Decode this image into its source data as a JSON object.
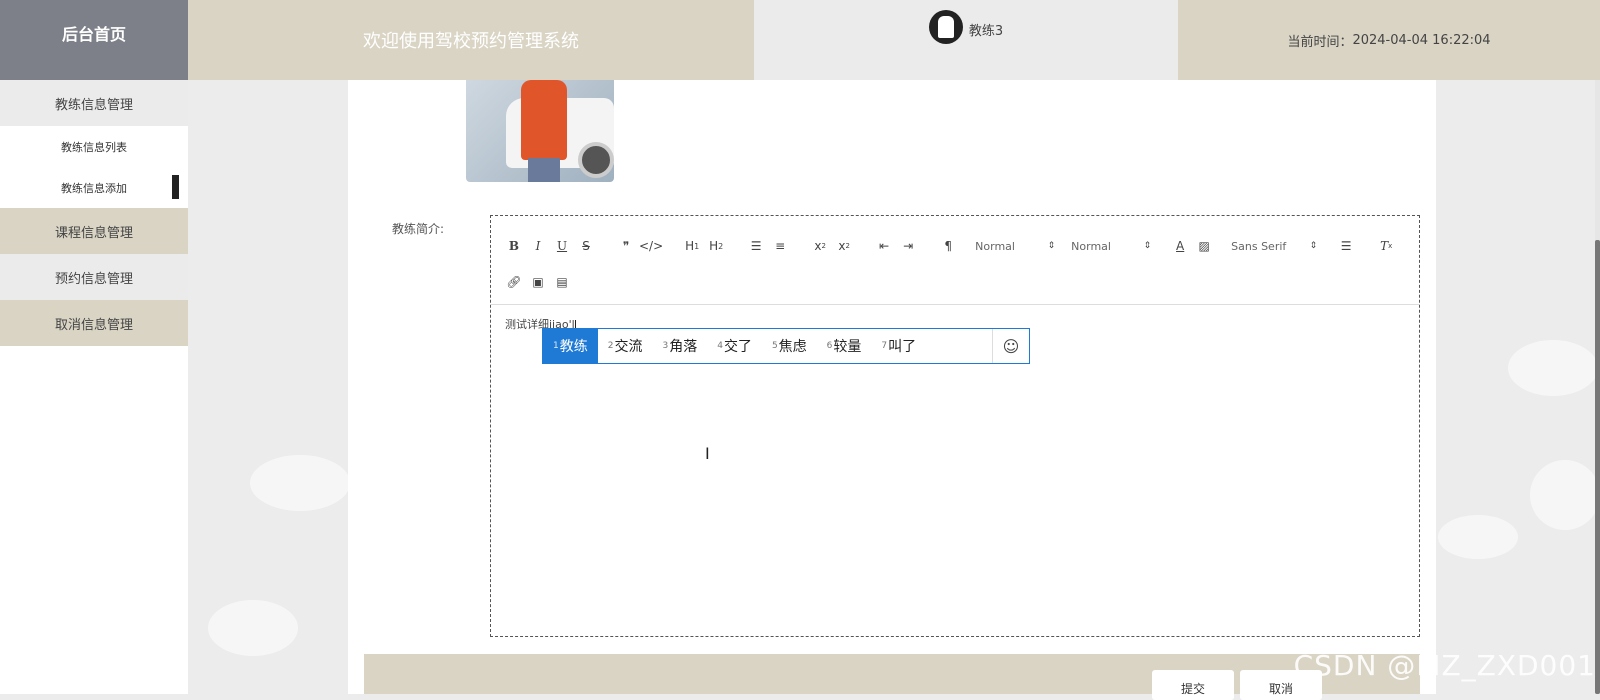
{
  "header": {
    "brand": "后台首页",
    "welcome": "欢迎使用驾校预约管理系统",
    "username": "教练3",
    "time_label": "当前时间：",
    "time_value": "2024-04-04 16:22:04"
  },
  "sidebar": {
    "groups": [
      {
        "label": "教练信息管理",
        "children": [
          "教练信息列表",
          "教练信息添加"
        ]
      },
      {
        "label": "课程信息管理"
      },
      {
        "label": "预约信息管理"
      },
      {
        "label": "取消信息管理"
      }
    ]
  },
  "form": {
    "intro_label": "教练简介:"
  },
  "editor": {
    "header_select": "Normal",
    "size_select": "Normal",
    "font_select": "Sans Serif",
    "content": "测试详细jiao'l"
  },
  "ime": {
    "candidates": [
      {
        "n": "1",
        "text": "教练"
      },
      {
        "n": "2",
        "text": "交流"
      },
      {
        "n": "3",
        "text": "角落"
      },
      {
        "n": "4",
        "text": "交了"
      },
      {
        "n": "5",
        "text": "焦虑"
      },
      {
        "n": "6",
        "text": "较量"
      },
      {
        "n": "7",
        "text": "叫了"
      }
    ],
    "active_index": 0
  },
  "buttons": {
    "submit": "提交",
    "cancel": "取消"
  },
  "watermark": "CSDN @MZ_ZXD001",
  "colors": {
    "brand_bg": "#7d8088",
    "tan": "#d9d4c4",
    "light": "#ebebeb",
    "accent": "#1f7ad6"
  }
}
